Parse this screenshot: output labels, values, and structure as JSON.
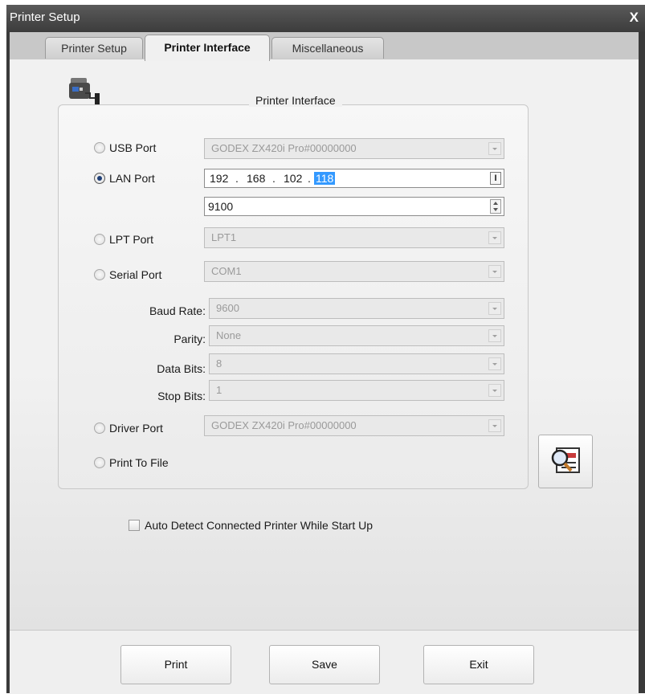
{
  "window": {
    "title": "Printer Setup",
    "close_label": "X"
  },
  "tabs": [
    {
      "label": "Printer Setup",
      "active": false
    },
    {
      "label": "Printer Interface",
      "active": true
    },
    {
      "label": "Miscellaneous",
      "active": false
    }
  ],
  "group": {
    "title": "Printer Interface",
    "icon": "printer-interface-icon"
  },
  "ports": {
    "usb": {
      "label": "USB Port",
      "checked": false,
      "value": "GODEX ZX420i Pro#00000000"
    },
    "lan": {
      "label": "LAN Port",
      "checked": true,
      "ip": {
        "o1": "192",
        "o2": "168",
        "o3": "102",
        "o4": "118",
        "sep": "."
      },
      "ip_button": "I",
      "port": "9100"
    },
    "lpt": {
      "label": "LPT Port",
      "checked": false,
      "value": "LPT1"
    },
    "serial": {
      "label": "Serial Port",
      "checked": false,
      "value": "COM1"
    },
    "baud": {
      "label": "Baud Rate:",
      "value": "9600"
    },
    "parity": {
      "label": "Parity:",
      "value": "None"
    },
    "data_bits": {
      "label": "Data Bits:",
      "value": "8"
    },
    "stop_bits": {
      "label": "Stop Bits:",
      "value": "1"
    },
    "driver": {
      "label": "Driver Port",
      "checked": false,
      "value": "GODEX ZX420i Pro#00000000"
    },
    "file": {
      "label": "Print To File",
      "checked": false
    }
  },
  "search_button_icon": "search-printer-icon",
  "auto_detect": {
    "label": "Auto Detect Connected Printer While Start Up",
    "checked": false
  },
  "buttons": {
    "print": "Print",
    "save": "Save",
    "exit": "Exit"
  }
}
